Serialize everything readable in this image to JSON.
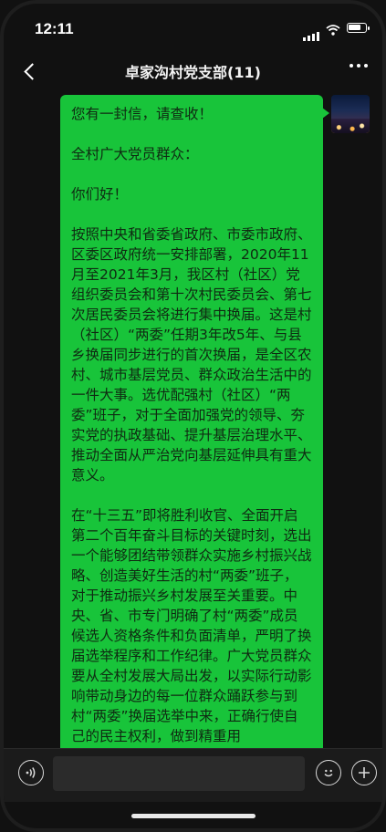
{
  "status_bar": {
    "time": "12:11",
    "battery_level": 0.8
  },
  "header": {
    "title": "卓家沟村党支部(11)"
  },
  "message": {
    "bubble_color": "#18c43a",
    "paragraphs": [
      "您有一封信，请查收！",
      "全村广大党员群众：",
      "你们好！",
      "按照中央和省委省政府、市委市政府、区委区政府统一安排部署，2020年11月至2021年3月，我区村（社区）党组织委员会和第十次村民委员会、第七次居民委员会将进行集中换届。这是村（社区）“两委”任期3年改5年、与县乡换届同步进行的首次换届，是全区农村、城市基层党员、群众政治生活中的一件大事。选优配强村（社区）“两委”班子，对于全面加强党的领导、夯实党的执政基础、提升基层治理水平、推动全面从严治党向基层延伸具有重大意义。",
      "在“十三五”即将胜利收官、全面开启第二个百年奋斗目标的关键时刻，选出一个能够团结带领群众实施乡村振兴战略、创造美好生活的村“两委”班子，对于推动振兴乡村发展至关重要。中央、省、市专门明确了村“两委”成员候选人资格条件和负面清单，严明了换届选举程序和工作纪律。广大党员群众要从全村发展大局出发，以实际行动影响带动身边的每一位群众踊跃参与到村“两委”换届选举中来，正确行使自己的民主权利，做到精重用"
    ]
  },
  "icons": {
    "back": "chevron-left-icon",
    "more": "more-dots-icon",
    "voice": "voice-icon",
    "emoji": "emoji-icon",
    "plus": "plus-icon"
  }
}
